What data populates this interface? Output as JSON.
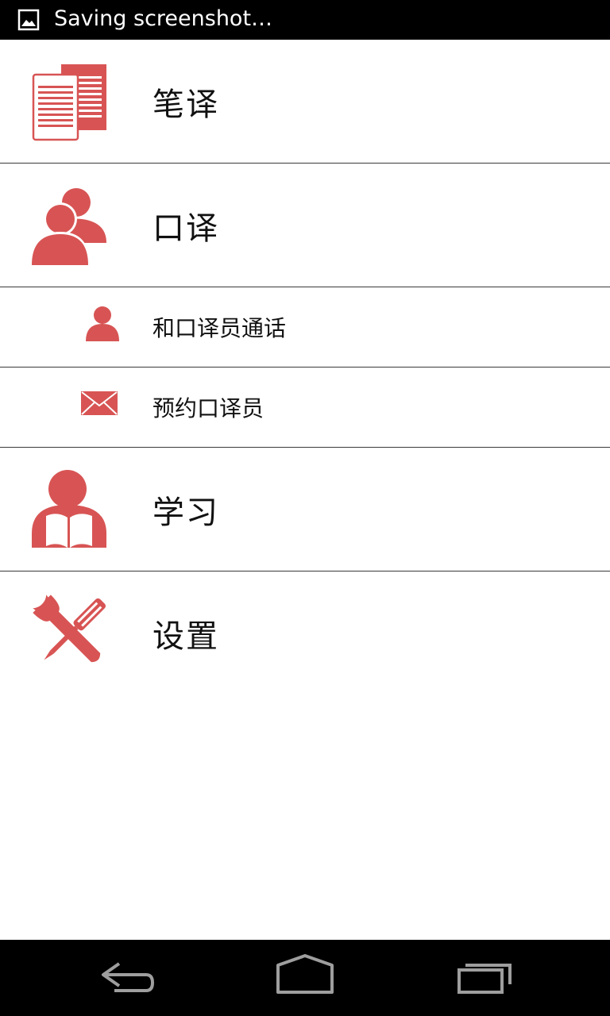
{
  "colors": {
    "accent": "#d85454",
    "status_bar": "#000000",
    "nav_bar": "#000000",
    "divider": "#3a3a3a",
    "nav_icon": "#9e9e9e"
  },
  "status_bar": {
    "icon": "image-icon",
    "text": "Saving screenshot…"
  },
  "menu": {
    "items": [
      {
        "label": "笔译",
        "icon": "documents-icon"
      },
      {
        "label": "口译",
        "icon": "people-icon"
      },
      {
        "label": "和口译员通话",
        "icon": "person-icon"
      },
      {
        "label": "预约口译员",
        "icon": "envelope-icon"
      },
      {
        "label": "学习",
        "icon": "reader-icon"
      },
      {
        "label": "设置",
        "icon": "tools-icon"
      }
    ]
  },
  "nav_bar": {
    "buttons": [
      {
        "icon": "back-icon"
      },
      {
        "icon": "home-icon"
      },
      {
        "icon": "recents-icon"
      }
    ]
  }
}
